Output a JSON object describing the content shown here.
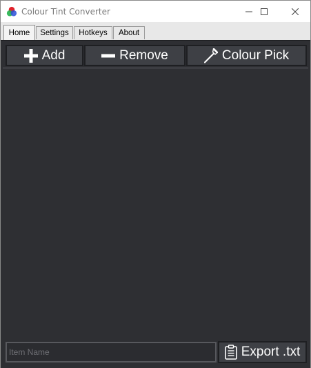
{
  "window": {
    "title": "Colour Tint Converter"
  },
  "tabs": [
    {
      "label": "Home",
      "active": true
    },
    {
      "label": "Settings",
      "active": false
    },
    {
      "label": "Hotkeys",
      "active": false
    },
    {
      "label": "About",
      "active": false
    }
  ],
  "toolbar": {
    "add_label": "Add",
    "remove_label": "Remove",
    "colour_pick_label": "Colour Pick"
  },
  "footer": {
    "item_name_placeholder": "Item Name",
    "item_name_value": "",
    "export_label": "Export .txt"
  },
  "icons": {
    "app": "rgb-circles-icon",
    "add": "plus-icon",
    "remove": "minus-icon",
    "colour_pick": "eyedropper-icon",
    "export": "clipboard-icon"
  },
  "colors": {
    "panel_bg": "#2e2f33",
    "button_bg": "#3e4045",
    "button_text": "#ffffff"
  }
}
